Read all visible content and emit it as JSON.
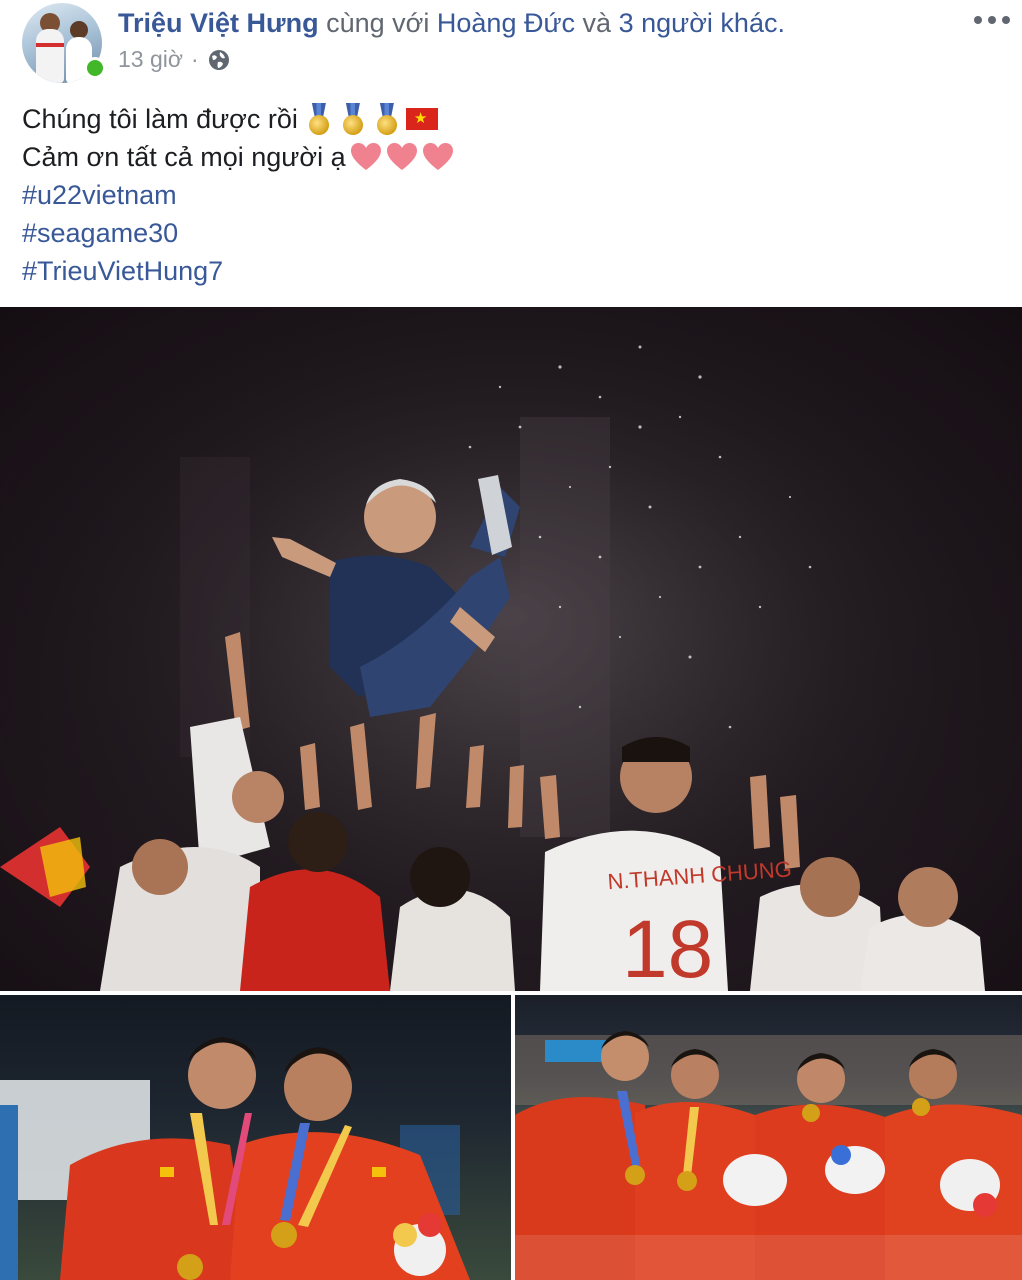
{
  "post": {
    "author": "Triệu Việt Hưng",
    "with_text": "cùng với",
    "tagged_person": "Hoàng Đức",
    "and_text": "và",
    "others": "3 người khác.",
    "time": "13 giờ",
    "dot": "·",
    "text_lines": [
      "Chúng tôi làm được rồi",
      "Cảm ơn tất cả mọi người ạ"
    ],
    "hashtags": [
      "#u22vietnam",
      "#seagame30",
      "#TrieuVietHung7"
    ]
  },
  "photos": {
    "main": {
      "jersey_name": "N.THANH CHUNG",
      "jersey_number": "18"
    }
  },
  "colors": {
    "link": "#385898",
    "text": "#1c1e21",
    "meta": "#90949c",
    "online": "#42b72a"
  }
}
